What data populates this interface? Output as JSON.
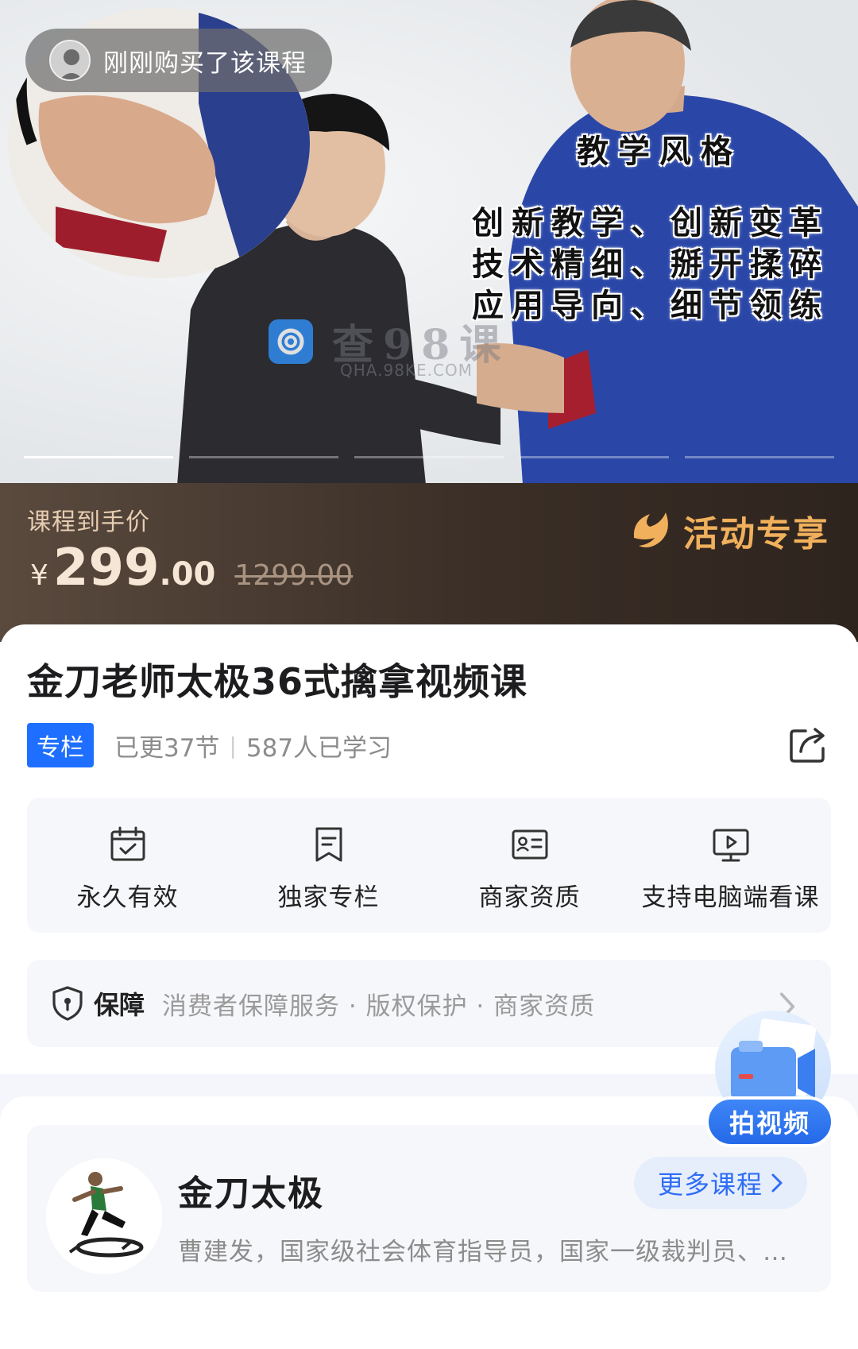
{
  "hero": {
    "buyer_toast": "刚刚购买了该课程",
    "overlay_title": "教学风格",
    "overlay_lines": [
      "创新教学、创新变革",
      "技术精细、掰开揉碎",
      "应用导向、细节领练"
    ],
    "watermark_main": "查98课",
    "watermark_sub": "QHA.98KE.COM",
    "slide_count": 5,
    "active_slide": 1
  },
  "price": {
    "label": "课程到手价",
    "currency": "¥",
    "integer": "299",
    "decimal": ".00",
    "original": "1299.00",
    "activity_label": "活动专享"
  },
  "course": {
    "title": "金刀老师太极36式擒拿视频课",
    "tag": "专栏",
    "updates": "已更37节",
    "separator": "|",
    "learners": "587人已学习"
  },
  "features": [
    {
      "icon": "calendar-check-icon",
      "label": "永久有效"
    },
    {
      "icon": "bookmark-doc-icon",
      "label": "独家专栏"
    },
    {
      "icon": "id-card-icon",
      "label": "商家资质"
    },
    {
      "icon": "monitor-play-icon",
      "label": "支持电脑端看课"
    }
  ],
  "guarantee": {
    "title": "保障",
    "items": "消费者保障服务 · 版权保护 · 商家资质"
  },
  "shop": {
    "name": "金刀太极",
    "more_label": "更多课程",
    "description": "曹建发，国家级社会体育指导员，国家一级裁判员、…"
  },
  "float_action": {
    "label": "拍视频"
  },
  "colors": {
    "accent_blue": "#1e6fff",
    "price_gold": "#f0b05c",
    "price_band": "#3b2f27"
  }
}
